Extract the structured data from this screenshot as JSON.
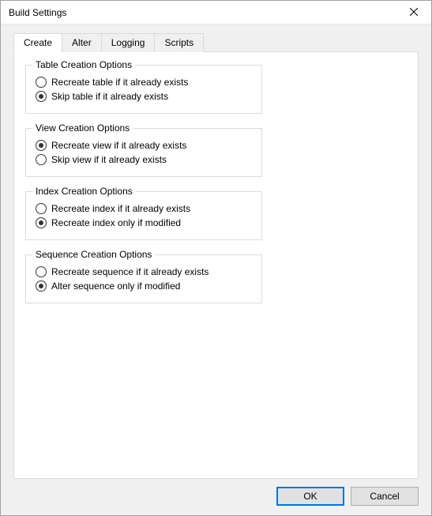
{
  "window": {
    "title": "Build Settings"
  },
  "tabs": [
    {
      "label": "Create",
      "active": true
    },
    {
      "label": "Alter",
      "active": false
    },
    {
      "label": "Logging",
      "active": false
    },
    {
      "label": "Scripts",
      "active": false
    }
  ],
  "groups": {
    "table": {
      "legend": "Table Creation Options",
      "options": [
        {
          "label": "Recreate table if it already exists",
          "selected": false
        },
        {
          "label": "Skip table if it already exists",
          "selected": true
        }
      ]
    },
    "view": {
      "legend": "View Creation Options",
      "options": [
        {
          "label": "Recreate view if it already exists",
          "selected": true
        },
        {
          "label": "Skip view if it already exists",
          "selected": false
        }
      ]
    },
    "index": {
      "legend": "Index Creation Options",
      "options": [
        {
          "label": "Recreate index if it already exists",
          "selected": false
        },
        {
          "label": "Recreate index only if modified",
          "selected": true
        }
      ]
    },
    "sequence": {
      "legend": "Sequence Creation Options",
      "options": [
        {
          "label": "Recreate sequence if it already exists",
          "selected": false
        },
        {
          "label": "Alter sequence only if modified",
          "selected": true
        }
      ]
    }
  },
  "buttons": {
    "ok": "OK",
    "cancel": "Cancel"
  }
}
